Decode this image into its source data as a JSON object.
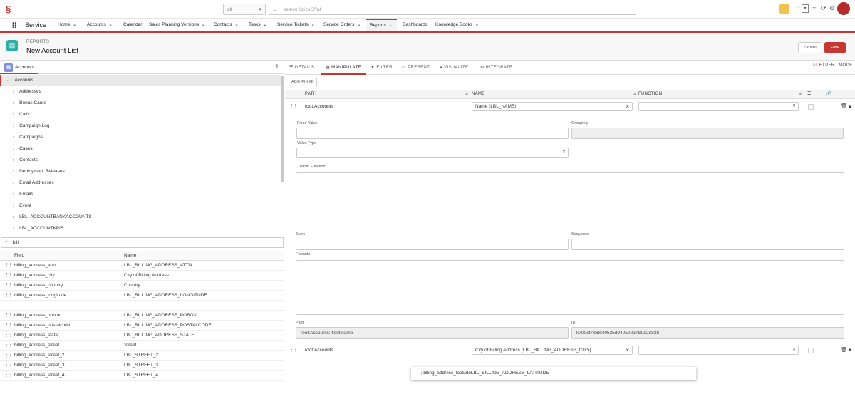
{
  "top": {
    "scope": "all",
    "search_placeholder": "search SpiceCRM"
  },
  "nav": {
    "app": "Service",
    "items": [
      "Home",
      "Accounts",
      "Calendar",
      "Sales Planning Versions",
      "Contacts",
      "Tasks",
      "Service Tickets",
      "Service Orders",
      "Reports",
      "Dashboards",
      "Knowledge Books"
    ],
    "active": "Reports"
  },
  "header": {
    "subtitle": "REPORTS",
    "title": "New Account List",
    "cancel": "cancel",
    "save": "save"
  },
  "left": {
    "tab": "Accounts",
    "tree_root": "Accounts",
    "tree": [
      "Addresses",
      "Bonus Cards",
      "Calls",
      "Campaign Log",
      "Campaigns",
      "Cases",
      "Contacts",
      "Deployment Releases",
      "Email Addresses",
      "Emails",
      "Event",
      "LBL_ACCOUNTBANKACCOUNTS",
      "LBL_ACCOUNTKPIS"
    ],
    "field_search": "bill",
    "col_field": "Field",
    "col_name": "Name",
    "fields": [
      {
        "field": "billing_address_attn",
        "name": "LBL_BILLING_ADDRESS_ATTN"
      },
      {
        "field": "billing_address_city",
        "name": "City of Billing Address"
      },
      {
        "field": "billing_address_country",
        "name": "Country"
      },
      {
        "field": "billing_address_longitude",
        "name": "LBL_BILLING_ADDRESS_LONGITUDE"
      },
      {
        "field": "",
        "name": ""
      },
      {
        "field": "billing_address_pobox",
        "name": "LBL_BILLING_ADDRESS_POBOX"
      },
      {
        "field": "billing_address_postalcode",
        "name": "LBL_BILLING_ADDRESS_POSTALCODE"
      },
      {
        "field": "billing_address_state",
        "name": "LBL_BILLING_ADDRESS_STATE"
      },
      {
        "field": "billing_address_street",
        "name": "Street"
      },
      {
        "field": "billing_address_street_2",
        "name": "LBL_STREET_2"
      },
      {
        "field": "billing_address_street_3",
        "name": "LBL_STREET_3"
      },
      {
        "field": "billing_address_street_4",
        "name": "LBL_STREET_4"
      }
    ]
  },
  "right": {
    "tabs": [
      "DETAILS",
      "MANIPULATE",
      "FILTER",
      "PRESENT",
      "VISUALIZE",
      "INTEGRATE"
    ],
    "active_tab": "MANIPULATE",
    "expert_mode": "EXPERT MODE",
    "add_fixed": "ADD FIXED",
    "col_path": "PATH",
    "col_name": "NAME",
    "col_function": "FUNCTION",
    "row1": {
      "path": "root:Accounts",
      "name": "Name  (LBL_NAME)"
    },
    "labels": {
      "fixed_value": "Fixed Value",
      "grouping": "Grouping",
      "value_type": "Value Type",
      "custom_function": "Custom Function",
      "store": "Store",
      "sequence": "Sequence",
      "formula": "Formula",
      "path": "Path",
      "id": "ID"
    },
    "path_value": "root:Accounts::field:name",
    "id_value": "k700ef7d6fd40535d94050027S0d2d838",
    "row2": {
      "path": "root:Accounts",
      "name": "City of Billing Address  (LBL_BILLING_ADDRESS_CITY)"
    },
    "drag_item": "billing_address_latitudeLBL_BILLING_ADDRESS_LATITUDE"
  }
}
